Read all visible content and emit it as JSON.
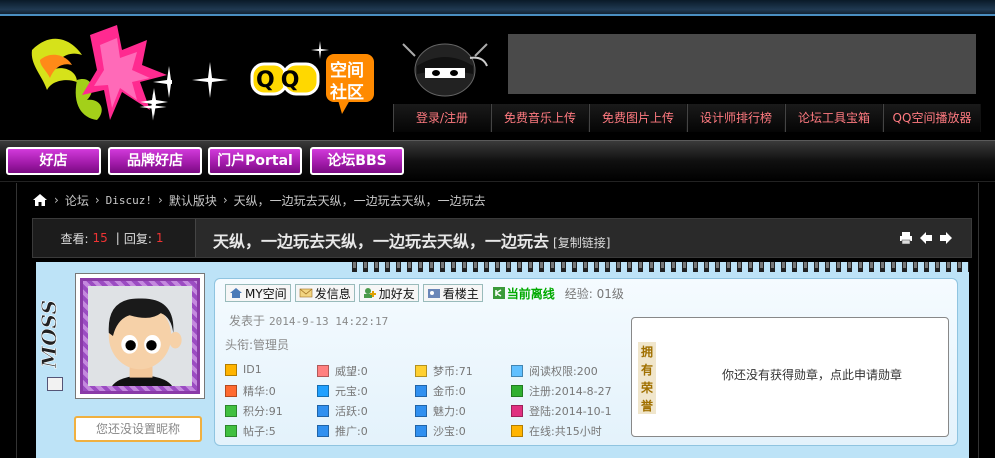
{
  "header": {
    "qq_logo_text": "QQ",
    "qq_logo_sub1": "空间",
    "qq_logo_sub2": "社区",
    "topnav": [
      "登录/注册",
      "免费音乐上传",
      "免费图片上传",
      "设计师排行榜",
      "论坛工具宝箱",
      "QQ空间播放器"
    ]
  },
  "navbar": {
    "items": [
      "好店",
      "品牌好店",
      "门户Portal",
      "论坛BBS"
    ]
  },
  "breadcrumb": {
    "forum": "论坛",
    "discuz": "Discuz!",
    "board": "默认版块",
    "thread": "天纵，一边玩去天纵，一边玩去天纵，一边玩去"
  },
  "thread": {
    "views_label": "查看:",
    "views": "15",
    "divider": "|",
    "replies_label": "回复:",
    "replies": "1",
    "title": "天纵，一边玩去天纵，一边玩去天纵，一边玩去",
    "copy_link": "[复制链接]"
  },
  "post": {
    "nickname_placeholder": "您还没设置昵称",
    "actions": [
      "MY空间",
      "发信息",
      "加好友",
      "看楼主"
    ],
    "online": "当前离线",
    "exp": "经验: 01级",
    "posted_label": "发表于",
    "posted_time": "2014-9-13 14:22:17",
    "rank": "头衔:管理员",
    "stats": [
      [
        "ID1",
        "威望:0",
        "梦币:71",
        "阅读权限:200"
      ],
      [
        "精华:0",
        "元宝:0",
        "金币:0",
        "注册:2014-8-27"
      ],
      [
        "积分:91",
        "活跃:0",
        "魅力:0",
        "登陆:2014-10-1"
      ],
      [
        "帖子:5",
        "推广:0",
        "沙宝:0",
        "在线:共15小时"
      ]
    ],
    "medal_tag": [
      "拥",
      "有",
      "荣",
      "誉"
    ],
    "medal_text": "你还没有获得勋章，点此申请勋章"
  },
  "colors": {
    "nav_purple": "#b02ab8",
    "topnav_text": "#ff7a80",
    "post_bg": "#bde3f7",
    "views_red": "#e33333"
  }
}
